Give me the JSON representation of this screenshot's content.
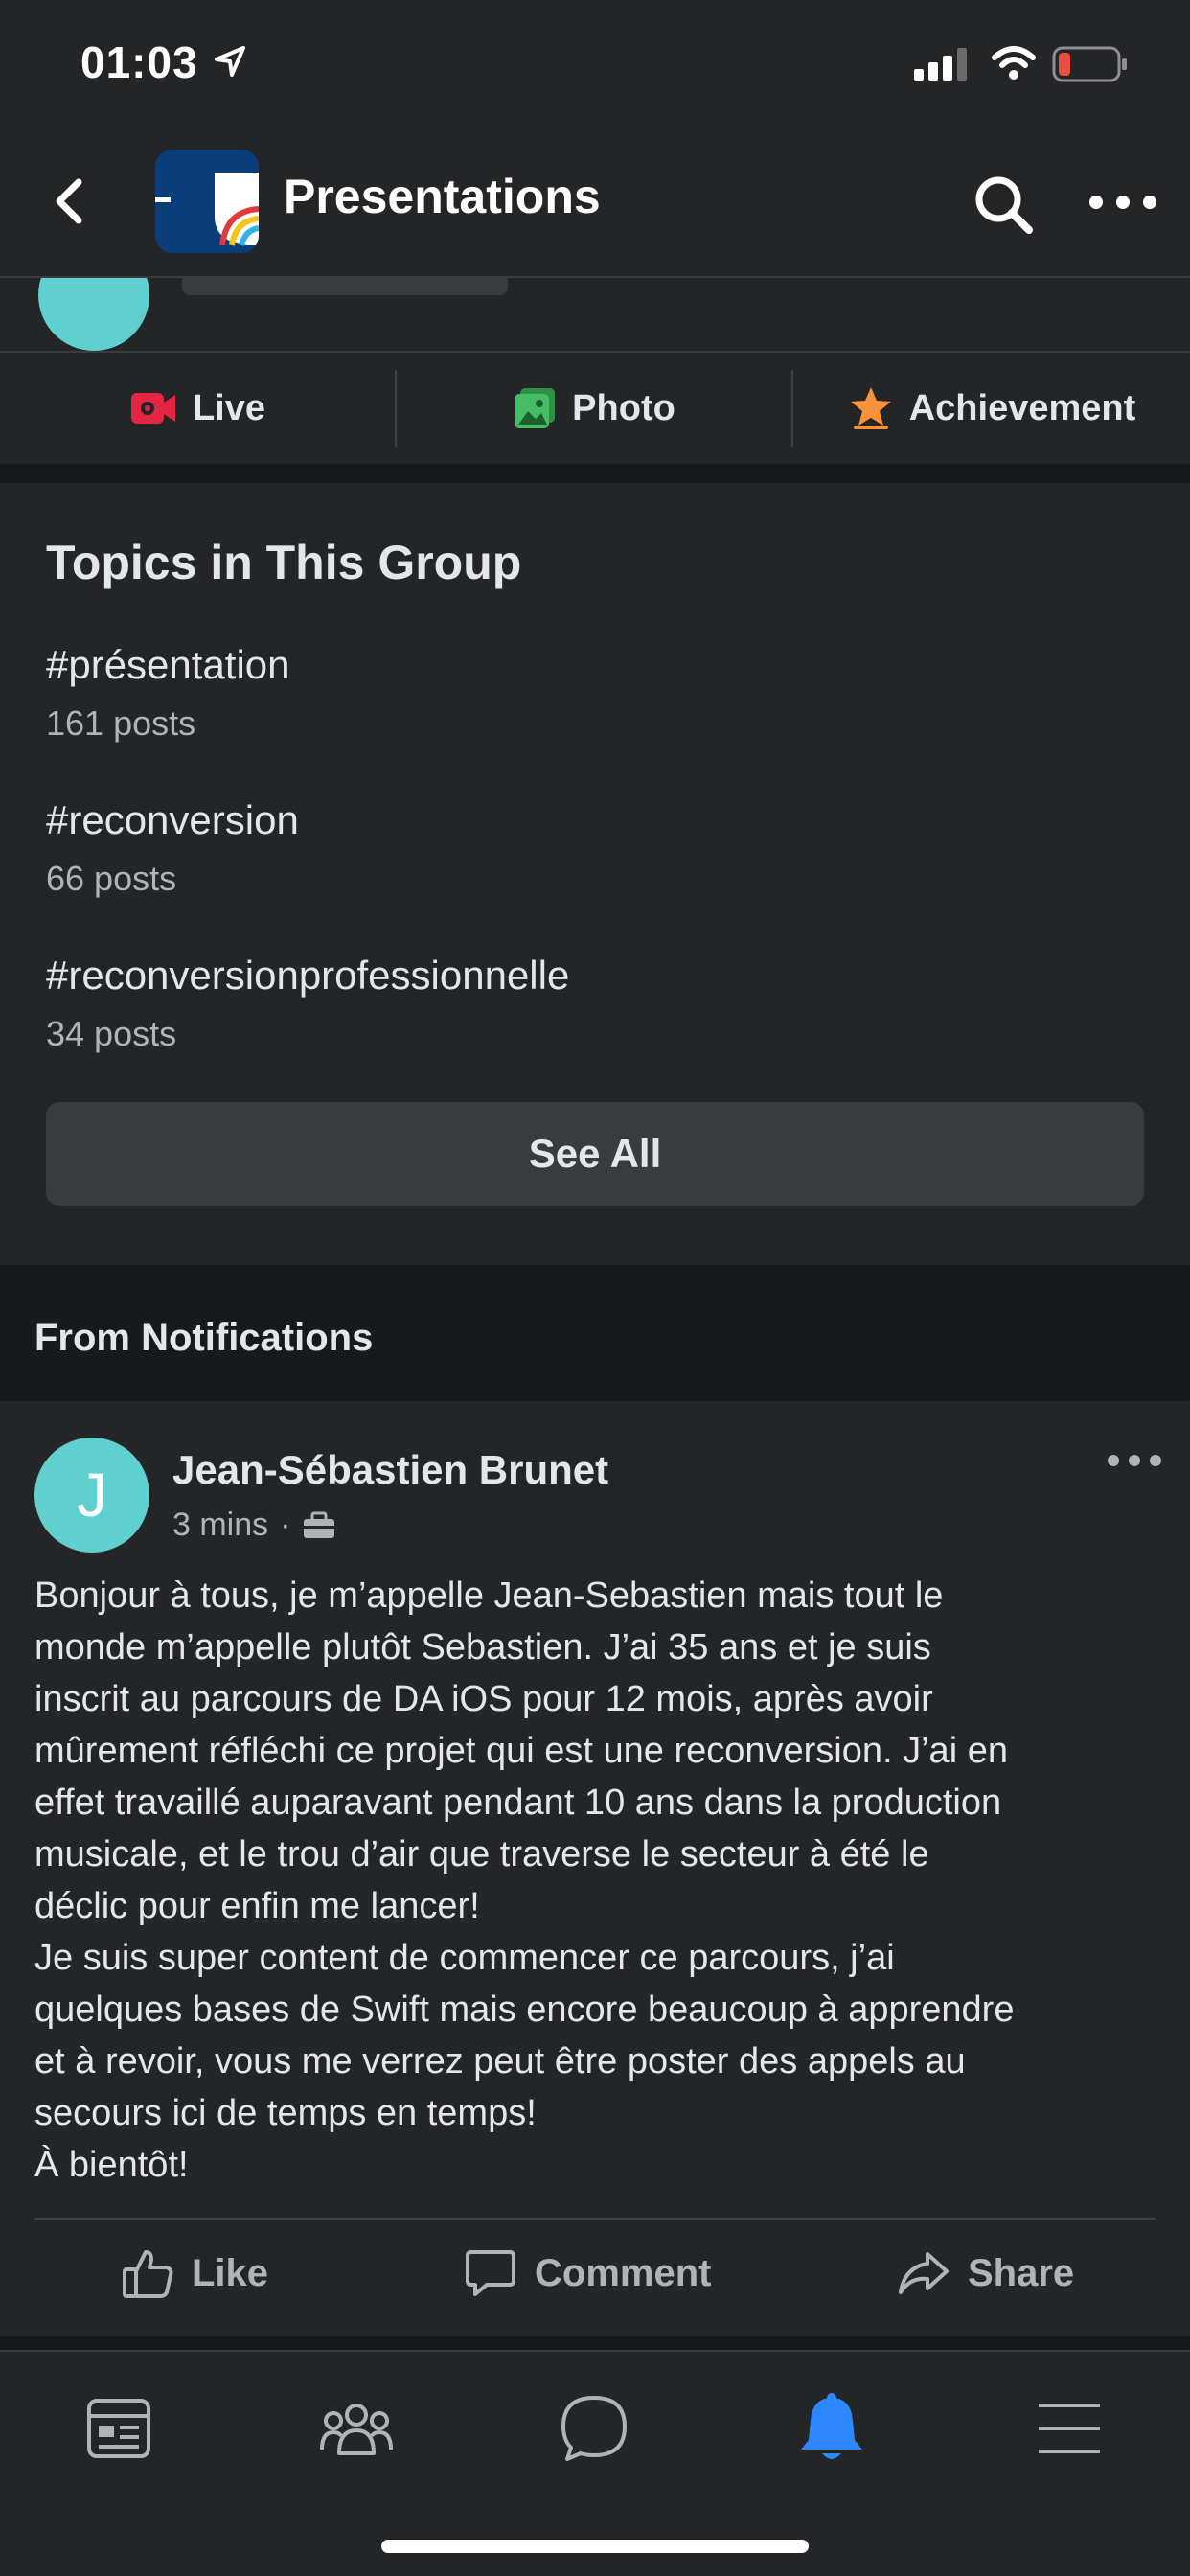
{
  "status_bar": {
    "time": "01:03"
  },
  "header": {
    "title": "Presentations"
  },
  "actions": [
    {
      "label": "Live",
      "icon": "live-video-icon"
    },
    {
      "label": "Photo",
      "icon": "photo-icon"
    },
    {
      "label": "Achievement",
      "icon": "achievement-star-icon"
    }
  ],
  "topics": {
    "title": "Topics in This Group",
    "items": [
      {
        "name": "#présentation",
        "count": "161 posts"
      },
      {
        "name": "#reconversion",
        "count": "66 posts"
      },
      {
        "name": "#reconversionprofessionnelle",
        "count": "34 posts"
      }
    ],
    "see_all": "See All"
  },
  "notifications": {
    "title": "From Notifications"
  },
  "post": {
    "avatar_letter": "J",
    "author": "Jean-Sébastien Brunet",
    "time": "3 mins",
    "separator": "·",
    "body": "Bonjour à tous, je m’appelle Jean-Sebastien mais tout le\nmonde m’appelle plutôt Sebastien. J’ai 35 ans et je suis\ninscrit au parcours de DA iOS pour 12 mois, après avoir\nmûrement réfléchi ce projet qui est une reconversion. J’ai en\neffet travaillé auparavant pendant 10 ans dans la production\nmusicale, et le trou d’air que traverse le secteur à été le\ndéclic pour enfin me lancer!\nJe suis super content de commencer ce parcours, j’ai\nquelques bases de Swift mais encore beaucoup à apprendre\net à revoir, vous me verrez peut être poster des appels au\nsecours ici de temps en temps!\nÀ bientôt!",
    "actions": {
      "like": "Like",
      "comment": "Comment",
      "share": "Share"
    }
  },
  "tab_bar": {
    "tabs": [
      "news-feed-icon",
      "groups-icon",
      "messenger-icon",
      "notifications-bell-icon",
      "menu-icon"
    ],
    "active": "notifications-bell-icon"
  },
  "colors": {
    "background": "#242526",
    "separator": "#18191a",
    "accent_blue": "#2d88ff",
    "live_red": "#e42645",
    "photo_green": "#45bd62",
    "achievement_orange": "#f7923b",
    "avatar_teal": "#5fcfd0"
  }
}
